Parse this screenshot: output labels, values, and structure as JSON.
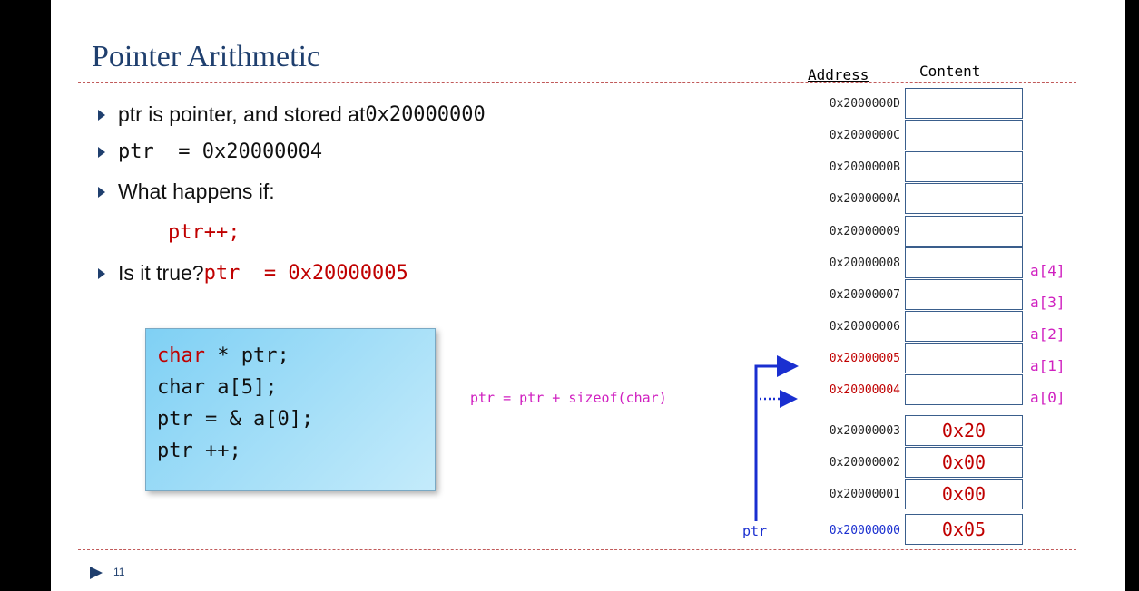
{
  "slide": {
    "title": "Pointer Arithmetic",
    "page_number": "11",
    "bullets": [
      {
        "text": "ptr is pointer, and stored at ",
        "mono": "0x20000000"
      },
      {
        "mono": "ptr  = 0x20000004"
      },
      {
        "text": "What happens if:"
      },
      {
        "code": "ptr++;"
      },
      {
        "text": "Is it true? ",
        "code": "ptr  = 0x20000005"
      }
    ],
    "code_box": {
      "lines": [
        "char * ptr;",
        "char a[5];",
        "ptr = & a[0];",
        "ptr ++;"
      ]
    }
  },
  "memory": {
    "address_header": "Address",
    "content_header": "Content",
    "rows": [
      {
        "address": "0x2000000D",
        "content": "",
        "label": ""
      },
      {
        "address": "0x2000000C",
        "content": "",
        "label": ""
      },
      {
        "address": "0x2000000B",
        "content": "",
        "label": ""
      },
      {
        "address": "0x2000000A",
        "content": "",
        "label": ""
      },
      {
        "address": "0x20000009",
        "content": "",
        "label": ""
      },
      {
        "address": "0x20000008",
        "content": "",
        "label": "a[4]"
      },
      {
        "address": "0x20000007",
        "content": "",
        "label": "a[3]"
      },
      {
        "address": "0x20000006",
        "content": "",
        "label": "a[2]"
      },
      {
        "address": "0x20000005",
        "content": "",
        "label": "a[1]"
      },
      {
        "address": "0x20000004",
        "content": "",
        "label": "a[0]"
      },
      {
        "address": "0x20000003",
        "content": "0x20",
        "label": ""
      },
      {
        "address": "0x20000002",
        "content": "0x00",
        "label": ""
      },
      {
        "address": "0x20000001",
        "content": "0x00",
        "label": ""
      },
      {
        "address": "0x20000000",
        "content": "0x05",
        "label": ""
      }
    ],
    "expression": "ptr = ptr + sizeof(char)",
    "pointer_label": "ptr",
    "colors": {
      "highlight_address": "#c00000",
      "pointer": "#1a2fd0",
      "element_label": "#d020c0"
    }
  }
}
